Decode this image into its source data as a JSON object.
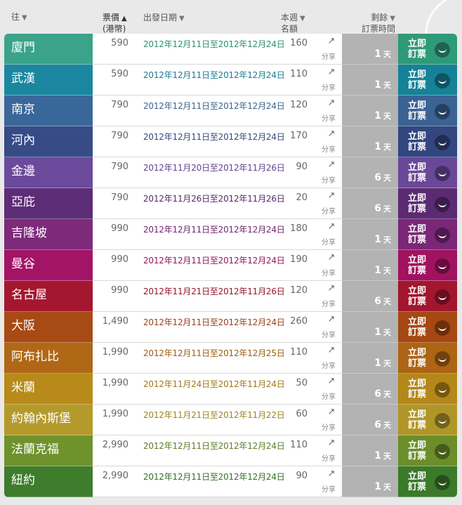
{
  "header": {
    "dest_label": "往",
    "price_label": "票價",
    "price_currency": "(港幣)",
    "price_sort_icon": "▲",
    "date_label": "出發日期",
    "quota_label_1": "本週",
    "quota_label_2": "名額",
    "remain_label_1": "剩餘",
    "remain_label_2": "訂票時間",
    "sort_icon": "▼"
  },
  "labels": {
    "share": "分享",
    "book": "立即訂票",
    "days_unit": "天"
  },
  "rows": [
    {
      "dest": "廈門",
      "price": "590",
      "date": "2012年12月11日至2012年12月24日",
      "quota": "160",
      "days": "1",
      "dest_color": "#3aa38a",
      "date_color": "#2e8f72",
      "book_color": "#2f9a78"
    },
    {
      "dest": "武漢",
      "price": "590",
      "date": "2012年12月11日至2012年12月24日",
      "quota": "110",
      "days": "1",
      "dest_color": "#1b86a0",
      "date_color": "#1b7b93",
      "book_color": "#158297"
    },
    {
      "dest": "南京",
      "price": "790",
      "date": "2012年12月11日至2012年12月24日",
      "quota": "120",
      "days": "1",
      "dest_color": "#3a6799",
      "date_color": "#39648f",
      "book_color": "#3a6394"
    },
    {
      "dest": "河內",
      "price": "790",
      "date": "2012年12月11日至2012年12月24日",
      "quota": "170",
      "days": "1",
      "dest_color": "#374c86",
      "date_color": "#35487c",
      "book_color": "#33467f"
    },
    {
      "dest": "金邊",
      "price": "790",
      "date": "2012年11月20日至2012年11月26日",
      "quota": "90",
      "days": "6",
      "dest_color": "#6b4a9c",
      "date_color": "#5f4390",
      "book_color": "#6a4898"
    },
    {
      "dest": "亞庇",
      "price": "790",
      "date": "2012年11月26日至2012年11月26日",
      "quota": "20",
      "days": "6",
      "dest_color": "#5e2d78",
      "date_color": "#532a6c",
      "book_color": "#5b2b72"
    },
    {
      "dest": "吉隆坡",
      "price": "990",
      "date": "2012年12月11日至2012年12月24日",
      "quota": "180",
      "days": "1",
      "dest_color": "#7d2a7b",
      "date_color": "#6e256d",
      "book_color": "#7a2778"
    },
    {
      "dest": "曼谷",
      "price": "990",
      "date": "2012年12月11日至2012年12月24日",
      "quota": "190",
      "days": "1",
      "dest_color": "#a31466",
      "date_color": "#94155f",
      "book_color": "#a1125f"
    },
    {
      "dest": "名古屋",
      "price": "990",
      "date": "2012年11月21日至2012年11月26日",
      "quota": "120",
      "days": "6",
      "dest_color": "#a4172f",
      "date_color": "#95162c",
      "book_color": "#a2162e"
    },
    {
      "dest": "大阪",
      "price": "1,490",
      "date": "2012年12月11日至2012年12月24日",
      "quota": "260",
      "days": "1",
      "dest_color": "#a84a14",
      "date_color": "#974214",
      "book_color": "#a54812"
    },
    {
      "dest": "阿布扎比",
      "price": "1,990",
      "date": "2012年12月11日至2012年12月25日",
      "quota": "110",
      "days": "1",
      "dest_color": "#b06816",
      "date_color": "#9c5c14",
      "book_color": "#ad6414"
    },
    {
      "dest": "米蘭",
      "price": "1,990",
      "date": "2012年11月24日至2012年11月24日",
      "quota": "50",
      "days": "6",
      "dest_color": "#b78a1a",
      "date_color": "#9f7816",
      "book_color": "#b48818"
    },
    {
      "dest": "約翰內斯堡",
      "price": "1,990",
      "date": "2012年11月21日至2012年11月22日",
      "quota": "60",
      "days": "6",
      "dest_color": "#b49a2b",
      "date_color": "#9a8424",
      "book_color": "#b09628"
    },
    {
      "dest": "法蘭克福",
      "price": "2,990",
      "date": "2012年12月11日至2012年12月24日",
      "quota": "110",
      "days": "1",
      "dest_color": "#6f922d",
      "date_color": "#5d7c26",
      "book_color": "#6b8e2a"
    },
    {
      "dest": "紐約",
      "price": "2,990",
      "date": "2012年12月11日至2012年12月24日",
      "quota": "90",
      "days": "1",
      "dest_color": "#3d7d2c",
      "date_color": "#356e26",
      "book_color": "#3b7a2a"
    }
  ]
}
